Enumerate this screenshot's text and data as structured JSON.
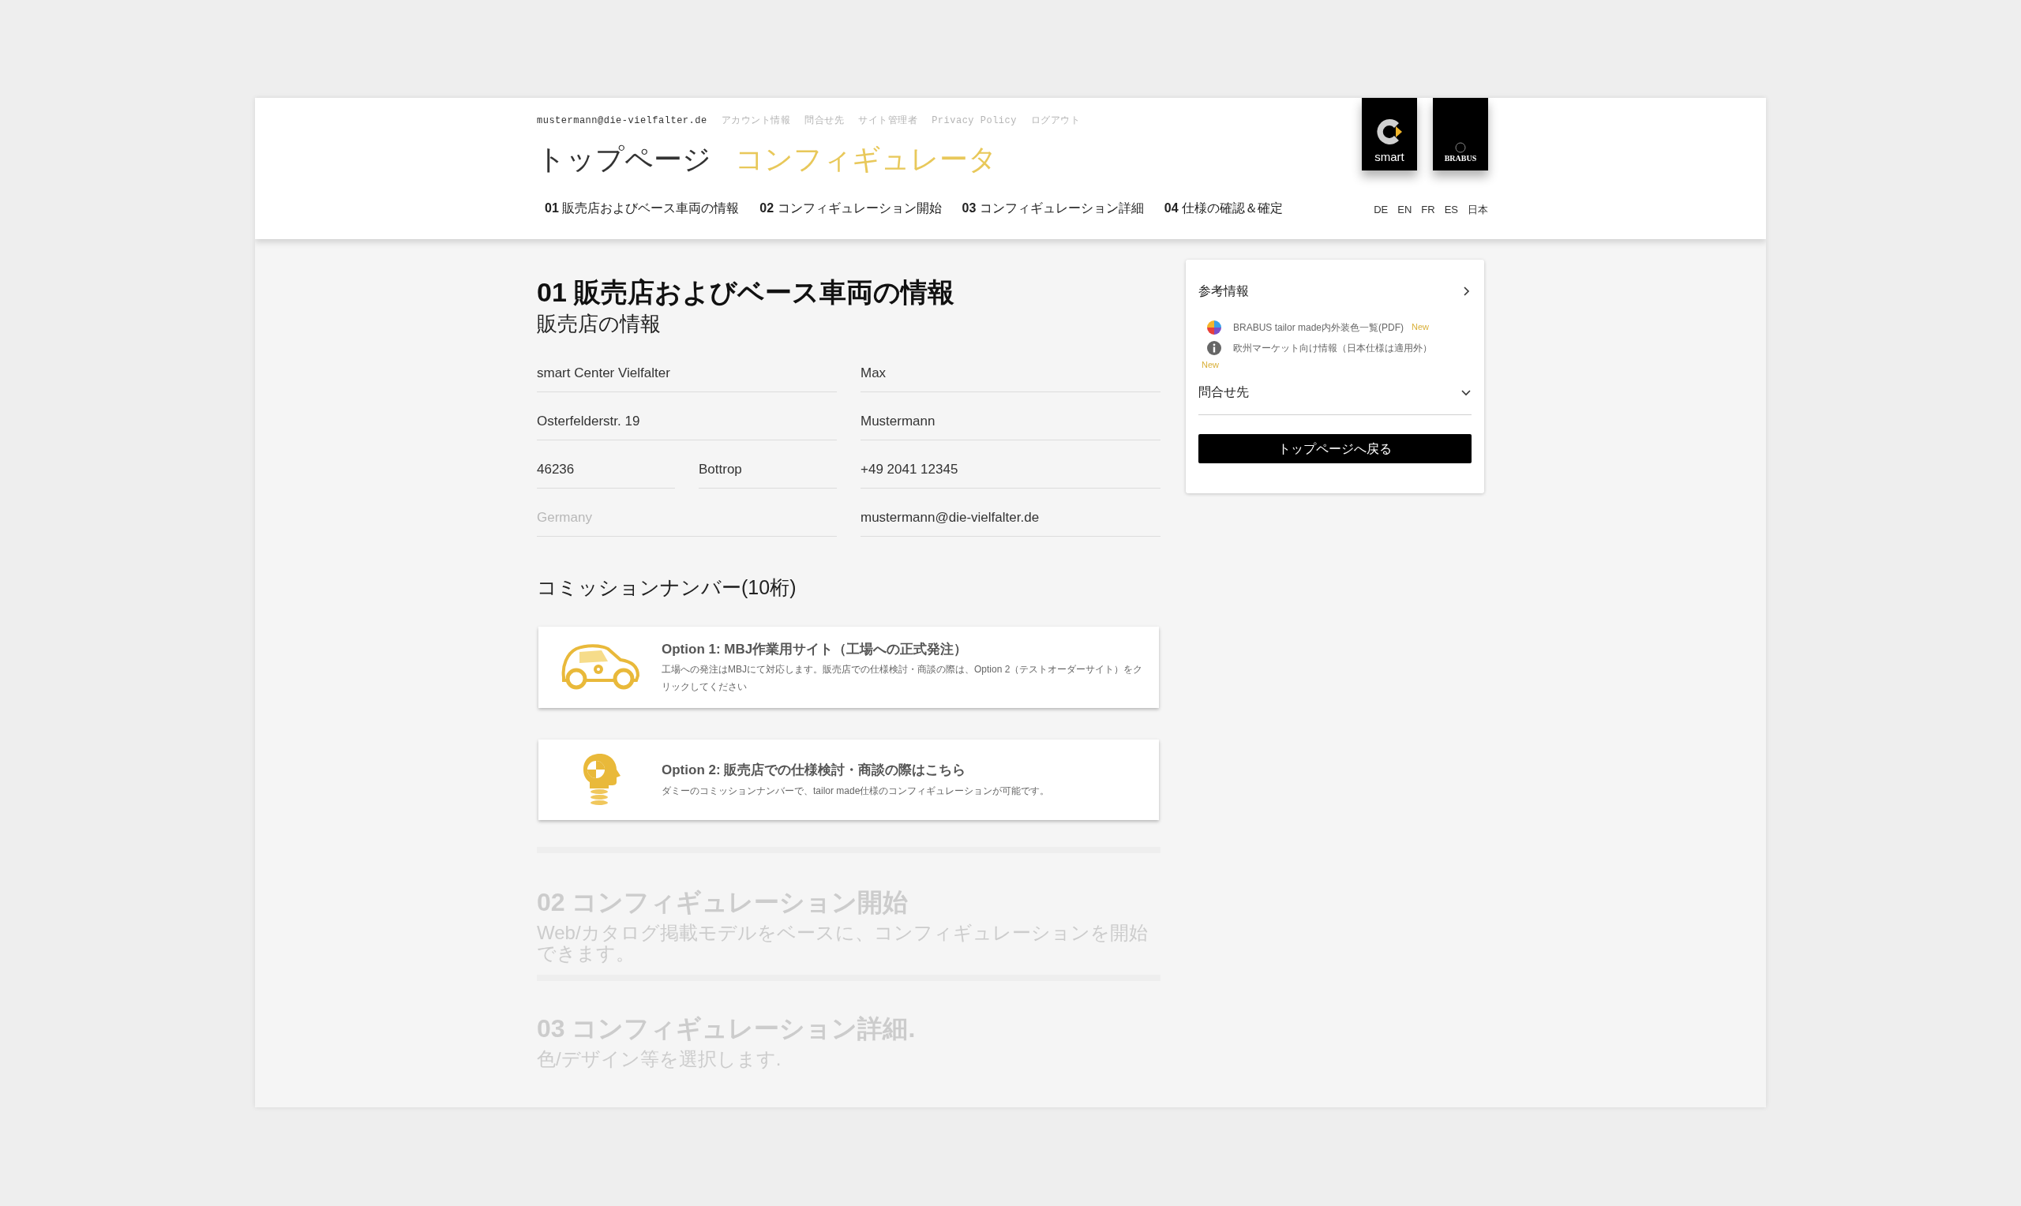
{
  "header": {
    "user_email": "mustermann@die-vielfalter.de",
    "links": [
      "アカウント情報",
      "問合せ先",
      "サイト管理者",
      "Privacy Policy",
      "ログアウト"
    ],
    "title": "トップページ",
    "subtitle": "コンフィギュレータ",
    "nav": [
      {
        "number": "01",
        "label": "販売店およびベース車両の情報"
      },
      {
        "number": "02",
        "label": "コンフィギュレーション開始"
      },
      {
        "number": "03",
        "label": "コンフィギュレーション詳細"
      },
      {
        "number": "04",
        "label": "仕様の確認＆確定"
      }
    ],
    "logos": [
      {
        "kind": "smart",
        "text": "smart"
      },
      {
        "kind": "brabus",
        "text": "BRABUS"
      }
    ],
    "languages": [
      "DE",
      "EN",
      "FR",
      "ES",
      "日本"
    ]
  },
  "section_01": {
    "title": "01 販売店およびベース車両の情報",
    "subtitle": "販売店の情報",
    "field_rows": [
      {
        "left": [
          {
            "value": "smart Center Vielfalter"
          }
        ],
        "right": {
          "value": "Max"
        }
      },
      {
        "left": [
          {
            "value": "Osterfelderstr. 19"
          }
        ],
        "right": {
          "value": "Mustermann"
        }
      },
      {
        "left": [
          {
            "value": "46236"
          },
          {
            "value": "Bottrop"
          }
        ],
        "right": {
          "value": "+49 2041 12345"
        }
      },
      {
        "left": [
          {
            "placeholder": "Germany"
          }
        ],
        "right": {
          "value": "mustermann@die-vielfalter.de"
        }
      }
    ],
    "commission_title": "コミッションナンバー(10桁)",
    "options": [
      {
        "kind": "car",
        "title": "Option 1: MBJ作業用サイト（工場への正式発注）",
        "description": "工場への発注はMBJにて対応します。販売店での仕様検討・商談の際は、Option 2（テストオーダーサイト）をクリックしてください"
      },
      {
        "kind": "dummy",
        "title": "Option 2: 販売店での仕様検討・商談の際はこちら",
        "description": "ダミーのコミッションナンバーで、tailor made仕様のコンフィギュレーションが可能です。"
      }
    ]
  },
  "later_steps": [
    {
      "title": "02 コンフィギュレーション開始",
      "description": "Web/カタログ掲載モデルをベースに、コンフィギュレーションを開始できます。"
    },
    {
      "title": "03 コンフィギュレーション詳細.",
      "description": "色/デザイン等を選択します."
    }
  ],
  "sidebar": {
    "sections": [
      {
        "title": "参考情報",
        "expanded": true,
        "items": [
          {
            "kind": "palette",
            "label": "BRABUS tailor made内外装色一覧(PDF)",
            "badge": "New"
          },
          {
            "kind": "info",
            "label": "欧州マーケット向け情報（日本仕様は適用外）",
            "badge": "New"
          }
        ]
      },
      {
        "title": "問合せ先",
        "expanded": false
      }
    ],
    "button": "トップページへ戻る"
  }
}
